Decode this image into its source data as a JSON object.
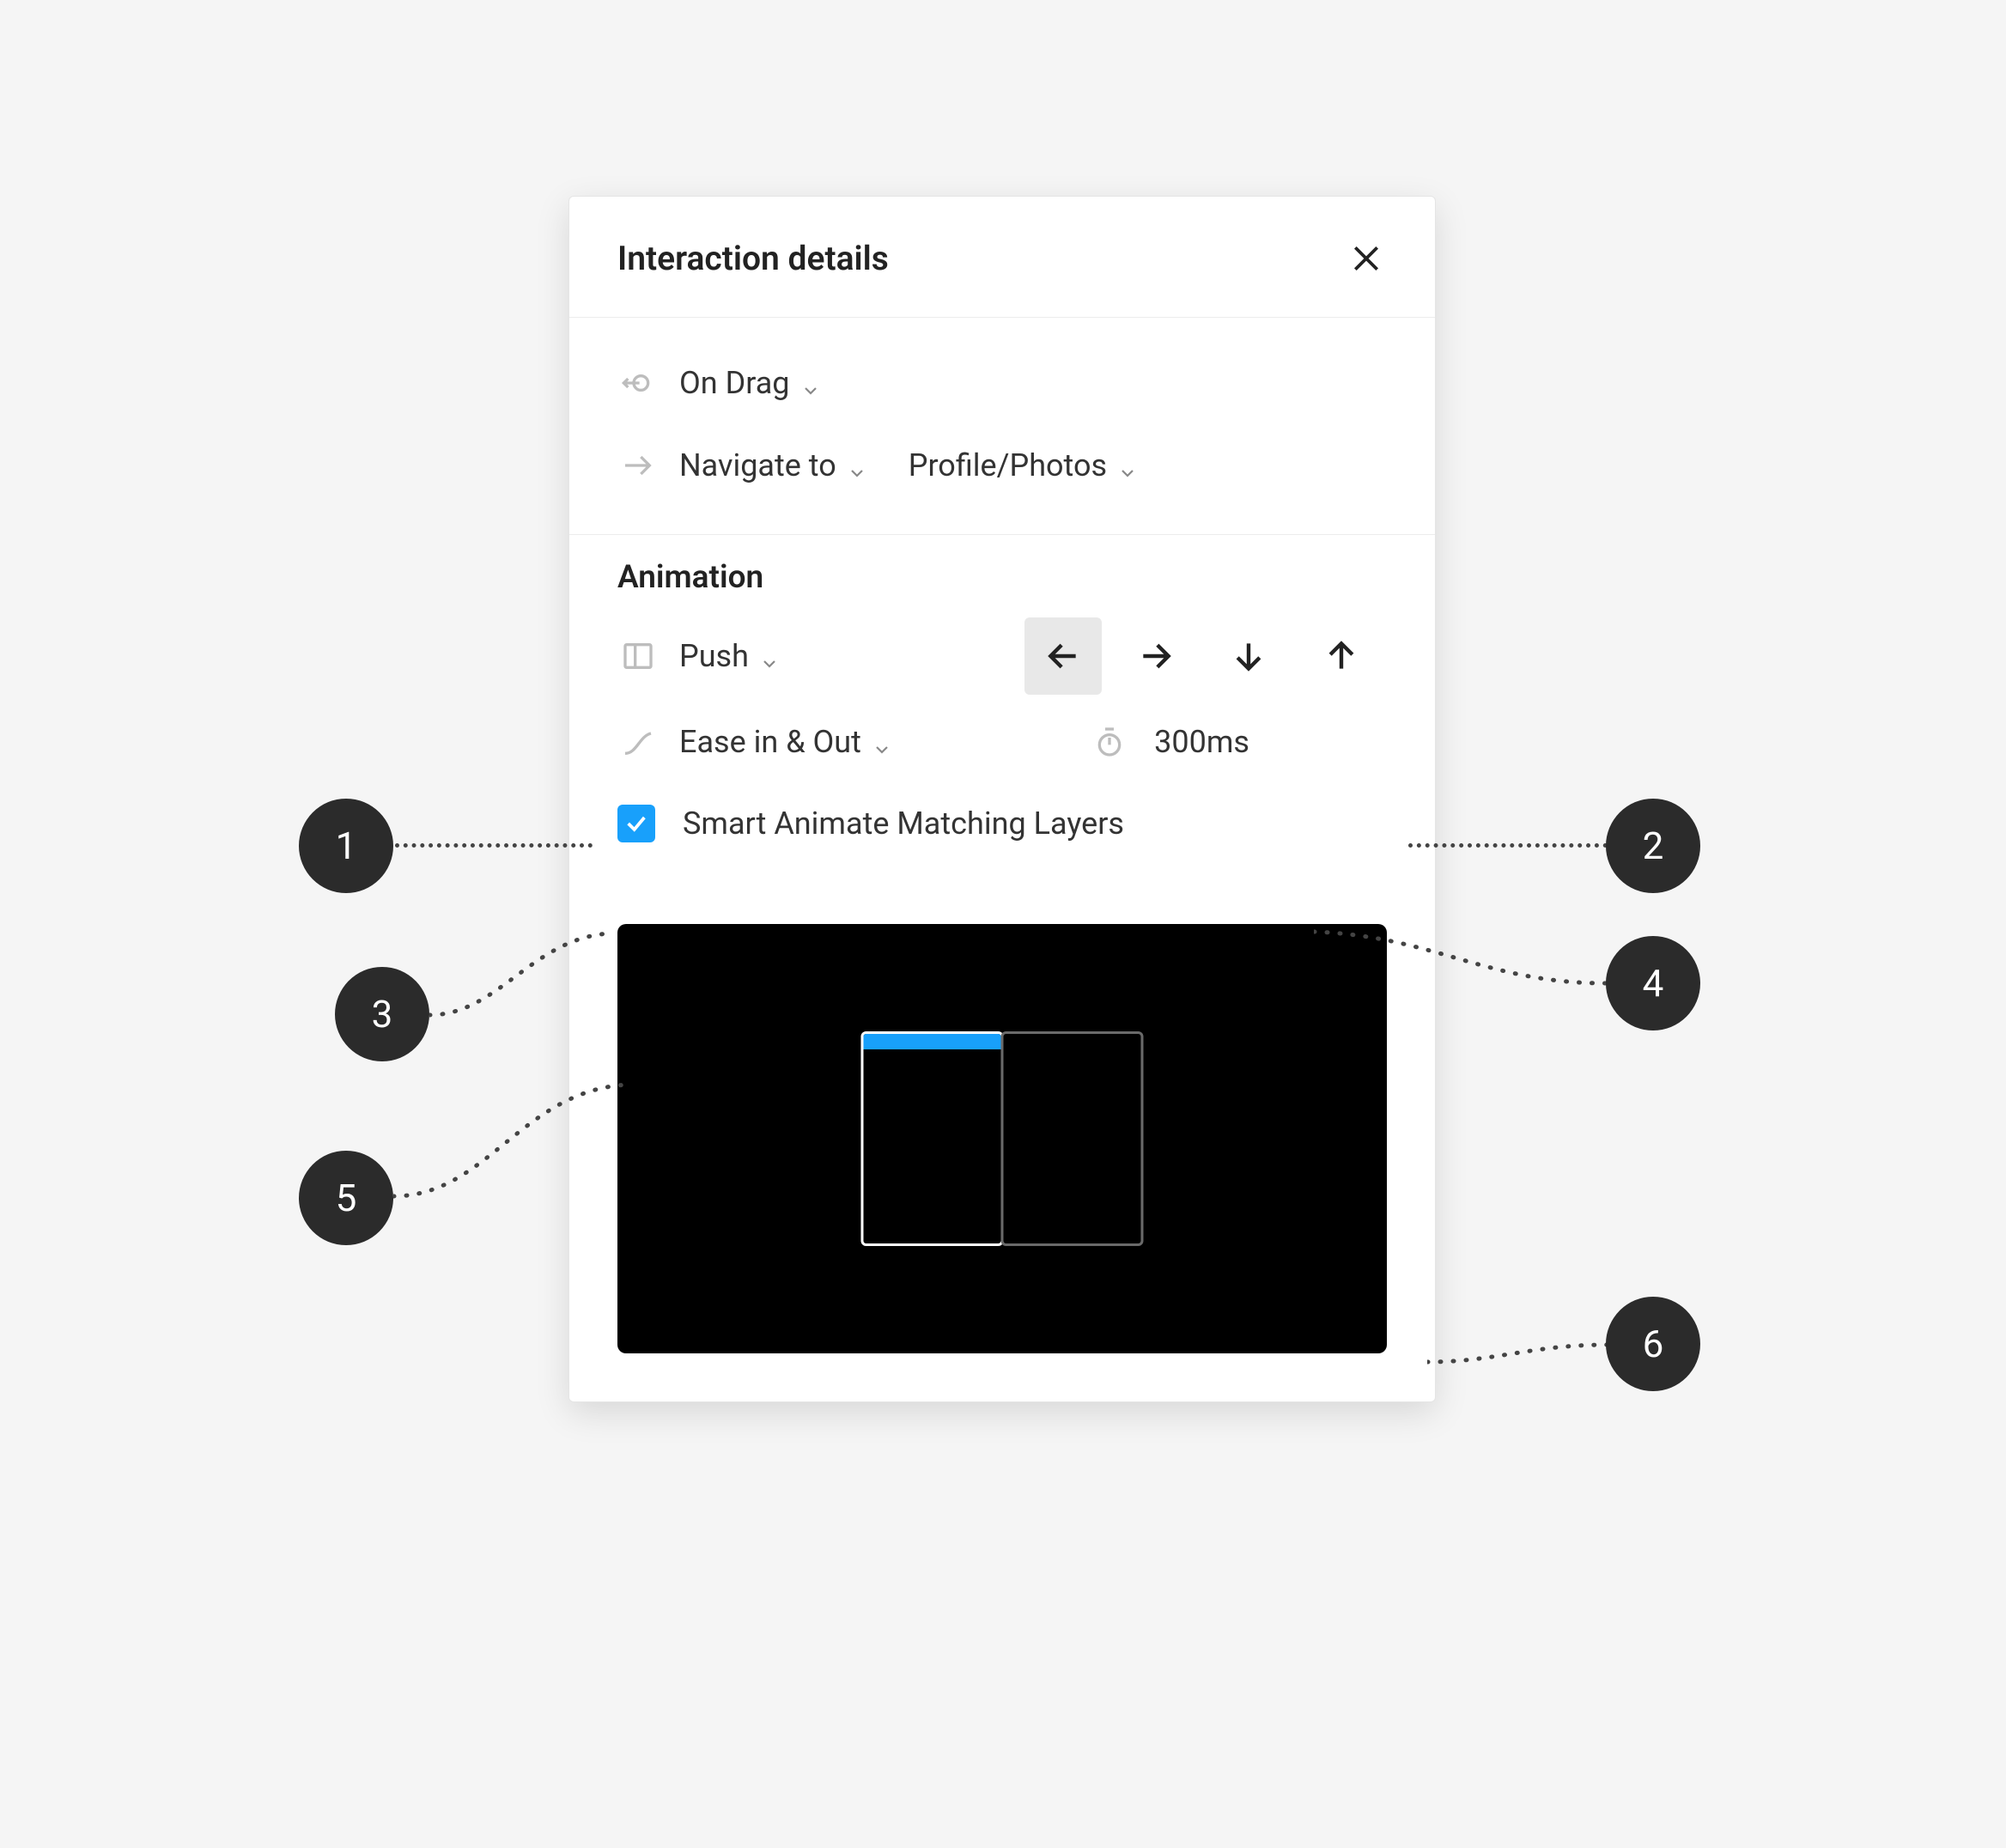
{
  "header": {
    "title": "Interaction details"
  },
  "trigger": {
    "label": "On Drag"
  },
  "action": {
    "label": "Navigate to",
    "target": "Profile/Photos"
  },
  "animation": {
    "section_label": "Animation",
    "type": "Push",
    "direction": "left",
    "easing": "Ease in & Out",
    "duration": "300ms",
    "smart_animate_label": "Smart Animate Matching Layers",
    "smart_animate_checked": true
  },
  "callouts": {
    "c1": "1",
    "c2": "2",
    "c3": "3",
    "c4": "4",
    "c5": "5",
    "c6": "6"
  }
}
